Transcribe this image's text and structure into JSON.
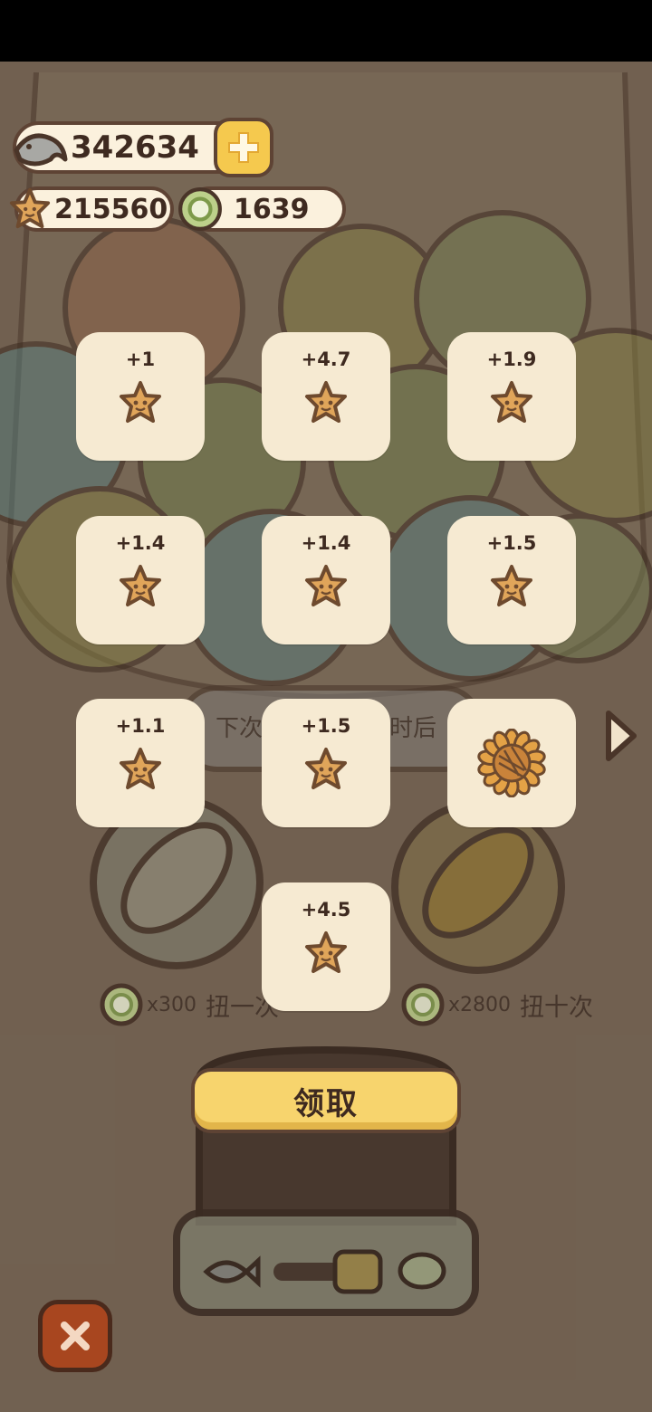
{
  "currency": {
    "fish": "342634",
    "star": "215560",
    "coin": "1639"
  },
  "rewards": [
    {
      "amount": "+1",
      "icon": "star-icon"
    },
    {
      "amount": "+4.7",
      "icon": "star-icon"
    },
    {
      "amount": "+1.9",
      "icon": "star-icon"
    },
    {
      "amount": "+1.4",
      "icon": "star-icon"
    },
    {
      "amount": "+1.4",
      "icon": "star-icon"
    },
    {
      "amount": "+1.5",
      "icon": "star-icon"
    },
    {
      "amount": "+1.1",
      "icon": "star-icon"
    },
    {
      "amount": "+1.5",
      "icon": "star-icon"
    },
    {
      "amount": "",
      "icon": "sunflower-icon"
    },
    {
      "amount": "+4.5",
      "icon": "star-icon"
    }
  ],
  "background": {
    "next_text_left": "下次",
    "next_text_right": "时后",
    "single_cost": "x300",
    "single_label": "扭一次",
    "ten_cost": "x2800",
    "ten_label": "扭十次"
  },
  "claim_label": "领取",
  "colors": {
    "card": "#f6ead2",
    "star": "#e0a55a",
    "button": "#f7d46d",
    "close": "#a8461f"
  }
}
